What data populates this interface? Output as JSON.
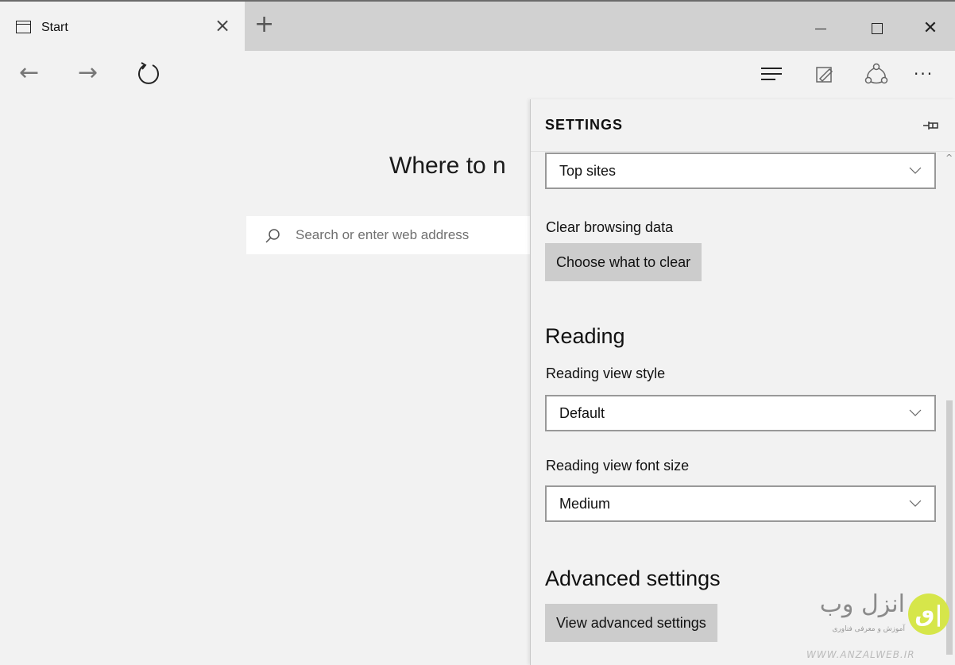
{
  "tab": {
    "title": "Start",
    "close_glyph": "×",
    "new_tab_glyph": "+"
  },
  "window_controls": {
    "close_glyph": "✕"
  },
  "nav": {
    "back_glyph": "←",
    "forward_glyph": "→",
    "more_glyph": "···"
  },
  "start_page": {
    "headline": "Where to n",
    "search_placeholder": "Search or enter web address"
  },
  "settings": {
    "title": "SETTINGS",
    "open_with_value": "Top sites",
    "clear_label": "Clear browsing data",
    "clear_button": "Choose what to clear",
    "reading_heading": "Reading",
    "reading_style_label": "Reading view style",
    "reading_style_value": "Default",
    "reading_font_label": "Reading view font size",
    "reading_font_value": "Medium",
    "advanced_heading": "Advanced settings",
    "advanced_button": "View advanced settings"
  },
  "watermark": {
    "logo": "ٯ|",
    "title": "انزل وب",
    "subtitle": "آموزش و معرفی فناوری",
    "url": "WWW.ANZALWEB.IR"
  },
  "colors": {
    "chrome": "#f2f2f2",
    "tabstrip": "#d1d1d1",
    "button": "#cccccc",
    "accent": "#d6e64a"
  },
  "icons": [
    "tab-page-icon",
    "close-icon",
    "plus-icon",
    "minimize-icon",
    "maximize-icon",
    "back-icon",
    "forward-icon",
    "refresh-icon",
    "hub-icon",
    "web-note-icon",
    "share-icon",
    "more-icon",
    "search-icon",
    "pin-icon",
    "chevron-down-icon"
  ]
}
